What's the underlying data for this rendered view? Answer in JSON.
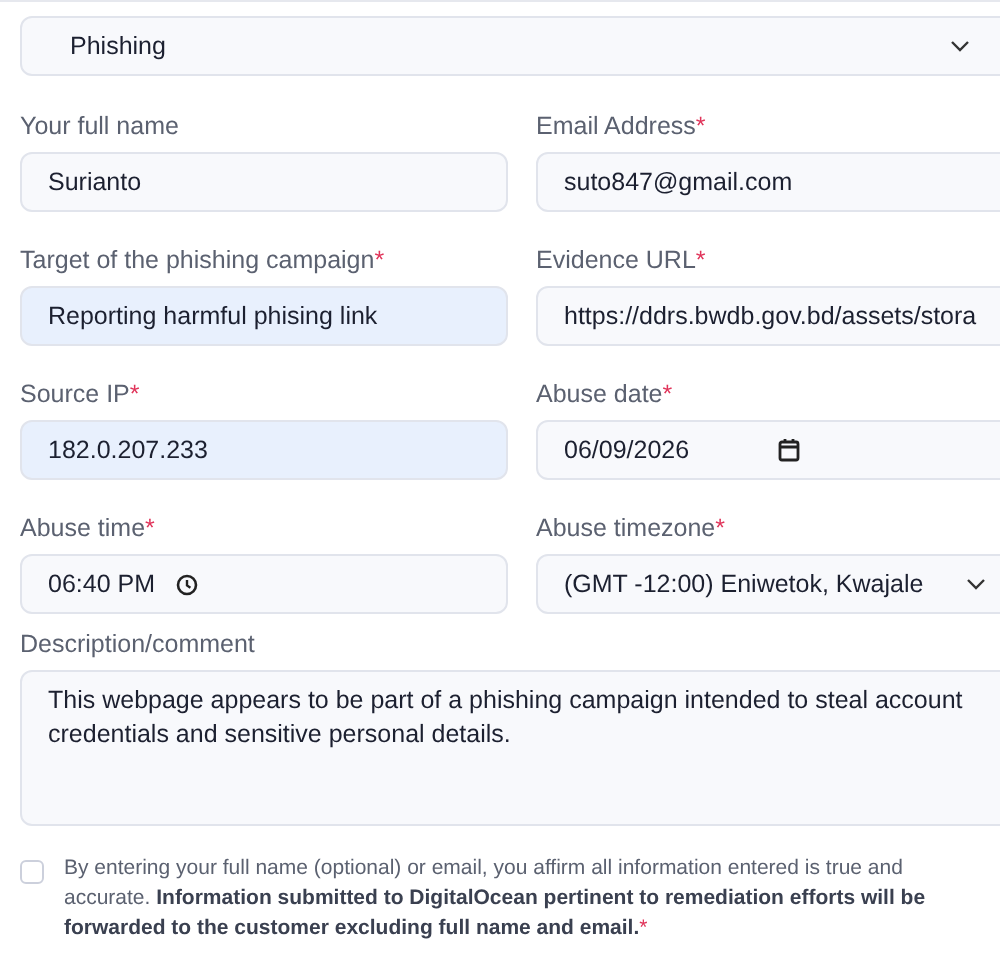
{
  "category": {
    "value": "Phishing"
  },
  "fields": [
    {
      "kind": "text",
      "label": "Your full name",
      "value": "Surianto",
      "autofilled": false
    },
    {
      "kind": "text",
      "label": "Email Address",
      "required_mark": "*",
      "value": "suto847@gmail.com",
      "autofilled": false
    },
    {
      "kind": "text",
      "label": "Target of the phishing campaign",
      "required_mark": "*",
      "value": "Reporting harmful phising link",
      "autofilled": true
    },
    {
      "kind": "text",
      "label": "Evidence URL",
      "required_mark": "*",
      "value": "https://ddrs.bwdb.gov.bd/assets/stora",
      "autofilled": false
    },
    {
      "kind": "text",
      "label": "Source IP",
      "required_mark": "*",
      "value": "182.0.207.233",
      "autofilled": true
    },
    {
      "kind": "date",
      "label": "Abuse date",
      "required_mark": "*",
      "value": "06/09/2026",
      "autofilled": false
    },
    {
      "kind": "time",
      "label": "Abuse time",
      "required_mark": "*",
      "value": "06:40 PM",
      "autofilled": false
    },
    {
      "kind": "select",
      "label": "Abuse timezone",
      "required_mark": "*",
      "value": "(GMT -12:00) Eniwetok, Kwajale",
      "autofilled": false
    }
  ],
  "description": {
    "label": "Description/comment",
    "value": "This webpage appears to be part of a phishing campaign intended to steal account credentials and sensitive personal details."
  },
  "consent": {
    "checked": false,
    "text": "By entering your full name (optional) or email, you affirm all information entered is true and accurate. **Information submitted to DigitalOcean pertinent to remediation efforts will be forwarded to the customer excluding full name and email.**",
    "required_mark": "*"
  }
}
